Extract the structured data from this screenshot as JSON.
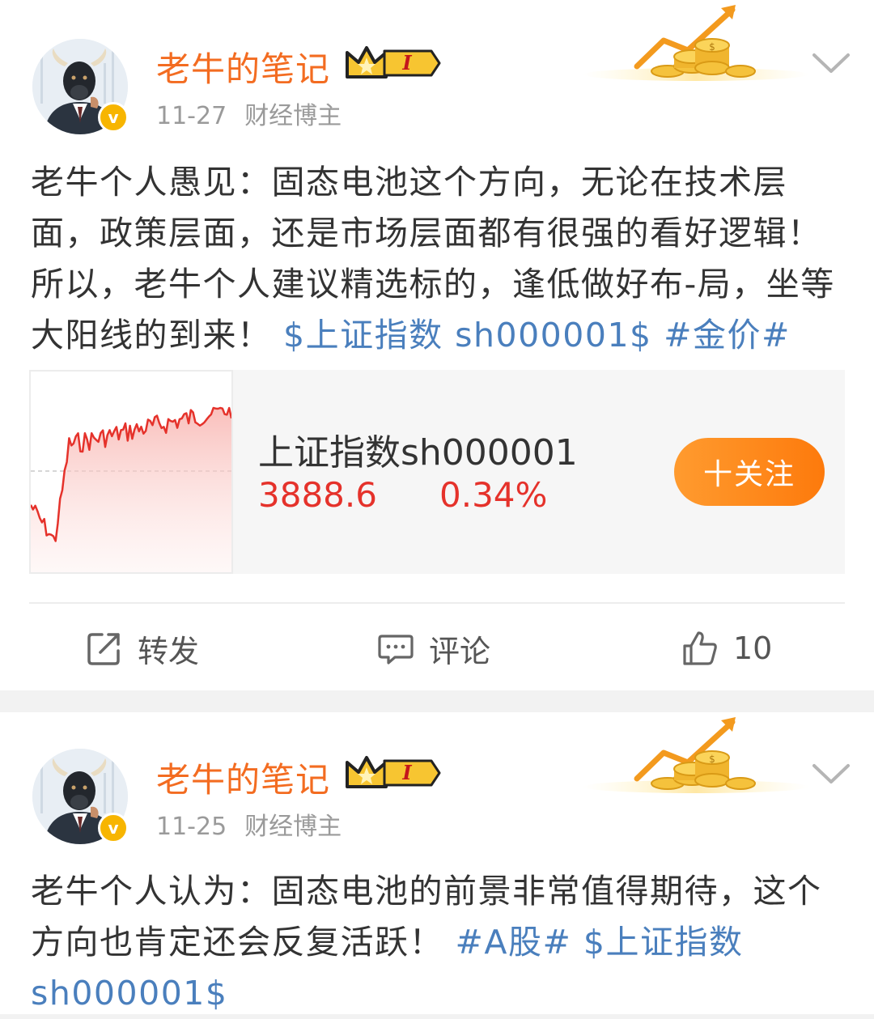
{
  "posts": [
    {
      "author": "老牛的笔记",
      "badge_level": "I",
      "date": "11-27",
      "tag": "财经博主",
      "verified_mark": "v",
      "text": "老牛个人愚见：固态电池这个方向，无论在技术层面，政策层面，还是市场层面都有很强的看好逻辑！所以，老牛个人建议精选标的，逢低做好布-局，坐等大阳线的到来！",
      "links": [
        "$上证指数 sh000001$",
        "#金价#"
      ],
      "stock_card": {
        "name": "上证指数sh000001",
        "price": "3888.6",
        "change": "0.34%",
        "follow_label": "十关注"
      },
      "actions": {
        "repost_label": "转发",
        "comment_label": "评论",
        "like_count": "10"
      }
    },
    {
      "author": "老牛的笔记",
      "badge_level": "I",
      "date": "11-25",
      "tag": "财经博主",
      "verified_mark": "v",
      "text": "老牛个人认为：固态电池的前景非常值得期待，这个方向也肯定还会反复活跃！",
      "links": [
        "#A股#",
        "$上证指数 sh000001$"
      ]
    }
  ],
  "colors": {
    "author": "#f36c21",
    "link": "#4a7fbd",
    "stock_up": "#e5322b",
    "follow_button": "#fd8a1c"
  },
  "icons": {
    "repost": "repost-icon",
    "comment": "comment-icon",
    "like": "thumbs-up-icon",
    "menu": "chevron-down-icon",
    "crown": "crown-badge-icon",
    "decoration": "gold-coins-growth-icon"
  }
}
